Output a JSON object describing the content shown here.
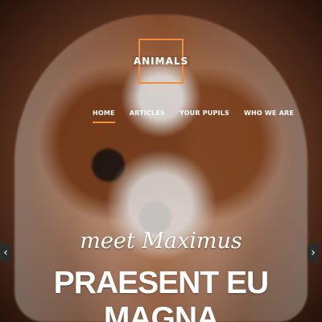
{
  "brand": {
    "logo_text": "ANIMALS",
    "accent": "#f08d3c"
  },
  "nav": {
    "items": [
      {
        "label": "HOME",
        "active": true
      },
      {
        "label": "ARTICLES",
        "active": false
      },
      {
        "label": "YOUR PUPILS",
        "active": false
      },
      {
        "label": "WHO WE ARE",
        "active": false
      }
    ]
  },
  "hero": {
    "subtitle": "meet Maximus",
    "headline": "PRAESENT EU MAGNA",
    "left_arrow": "‹",
    "right_arrow": "›"
  }
}
